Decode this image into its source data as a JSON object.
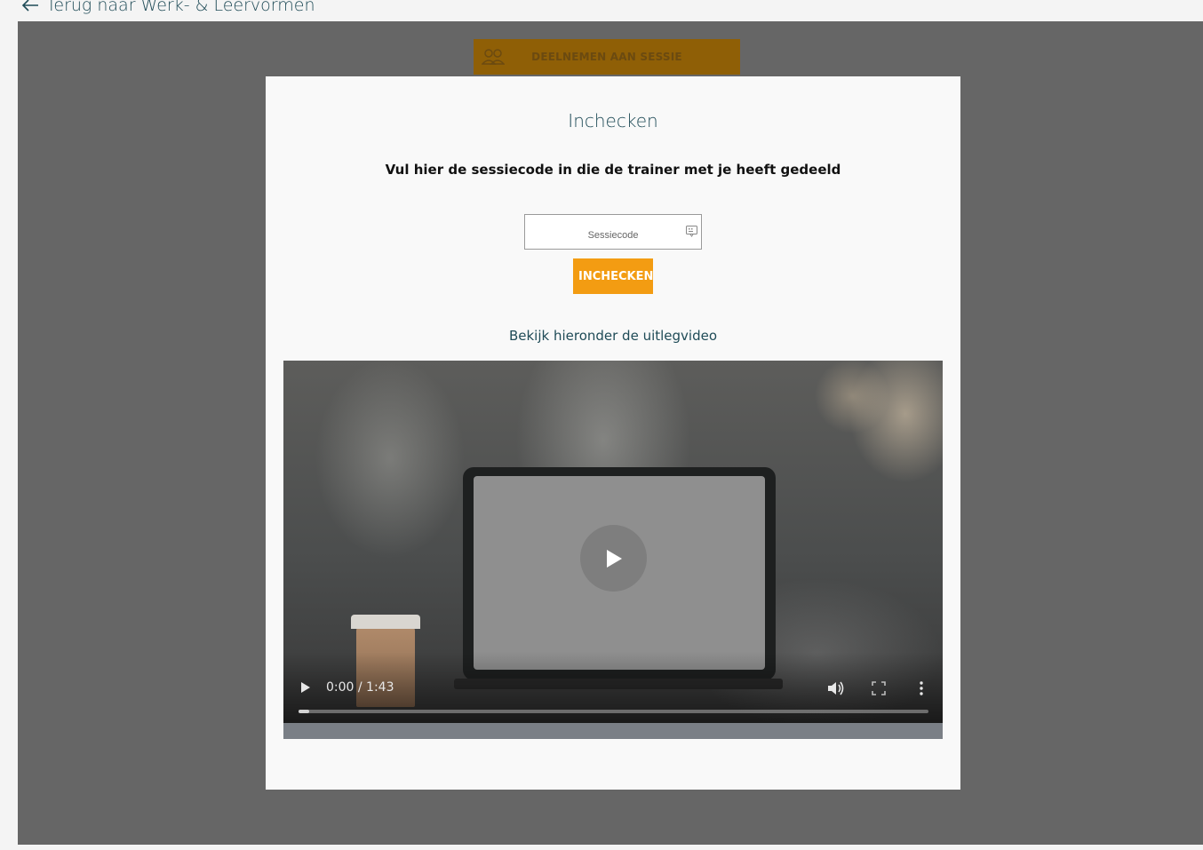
{
  "nav": {
    "back_label": "Terug naar Werk- & Leervormen"
  },
  "join_button": {
    "label": "DEELNEMEN AAN SESSIE",
    "icon": "users-icon"
  },
  "modal": {
    "title": "Inchecken",
    "instruction": "Vul hier de sessiecode in die de trainer met je heeft gedeeld",
    "code_field": {
      "value": "",
      "placeholder": "Sessiecode",
      "icon": "keyboard-icon"
    },
    "checkin_button": "INCHECKEN",
    "video_caption": "Bekijk hieronder de uitlegvideo"
  },
  "video": {
    "current_time": "0:00",
    "duration": "1:43",
    "time_display": "0:00 / 1:43",
    "progress": 0
  },
  "colors": {
    "accent": "#f39c12",
    "text_dark_teal": "#1f4b57",
    "backdrop": "#666666"
  }
}
